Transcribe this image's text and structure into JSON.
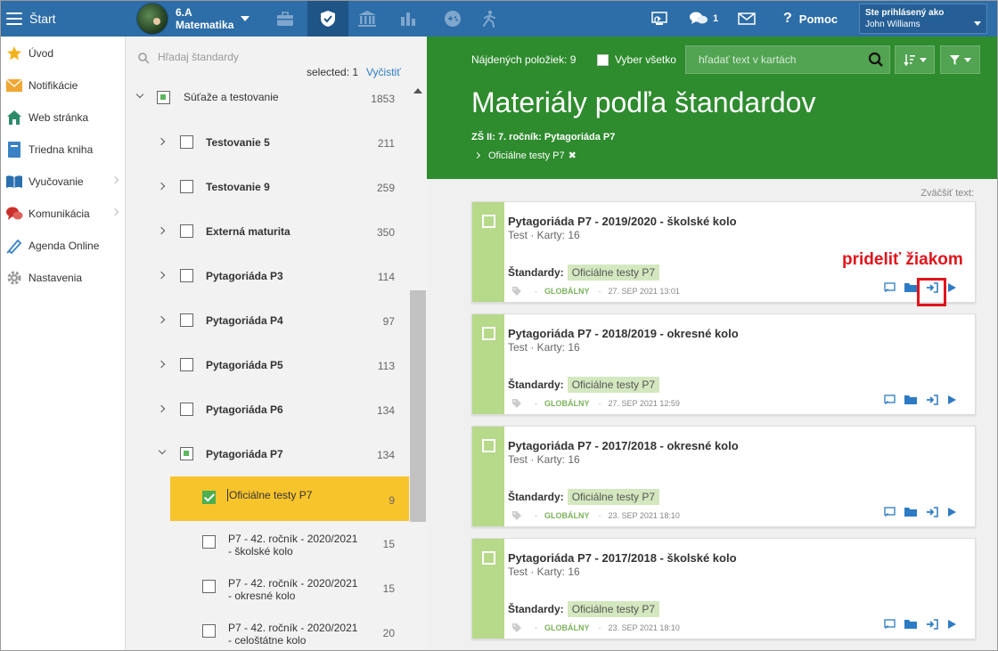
{
  "topbar": {
    "start_label": "Štart",
    "class_name": "6.A",
    "subject": "Matematika",
    "message_count": "1",
    "help_label": "Pomoc",
    "logged_in_label": "Ste prihlásený ako",
    "user_name": "John Williams",
    "colors": {
      "bar": "#2d6da8",
      "active_tab": "#1f5486"
    }
  },
  "leftnav": {
    "items": [
      {
        "label": "Úvod",
        "icon": "star-icon"
      },
      {
        "label": "Notifikácie",
        "icon": "envelope-icon"
      },
      {
        "label": "Web stránka",
        "icon": "house-icon"
      },
      {
        "label": "Triedna kniha",
        "icon": "book-icon"
      },
      {
        "label": "Vyučovanie",
        "icon": "open-book-icon"
      },
      {
        "label": "Komunikácia",
        "icon": "chat-icon"
      },
      {
        "label": "Agenda Online",
        "icon": "pen-icon"
      },
      {
        "label": "Nastavenia",
        "icon": "gear-icon"
      }
    ]
  },
  "tree": {
    "search_placeholder": "Hľadaj štandardy",
    "selected_label": "selected: 1",
    "clear_label": "Vyčistiť",
    "rows": [
      {
        "label": "Súťaže a testovanie",
        "count": "1853"
      },
      {
        "label": "Testovanie 5",
        "count": "211"
      },
      {
        "label": "Testovanie 9",
        "count": "259"
      },
      {
        "label": "Externá maturita",
        "count": "350"
      },
      {
        "label": "Pytagoriáda P3",
        "count": "114"
      },
      {
        "label": "Pytagoriáda P4",
        "count": "97"
      },
      {
        "label": "Pytagoriáda P5",
        "count": "113"
      },
      {
        "label": "Pytagoriáda P6",
        "count": "134"
      },
      {
        "label": "Pytagoriáda P7",
        "count": "134"
      },
      {
        "label": "Oficiálne testy P7",
        "count": "9"
      },
      {
        "label1": "P7 - 42. ročník - 2020/2021",
        "label2": "- školské kolo",
        "count": "15"
      },
      {
        "label1": "P7 - 42. ročník - 2020/2021",
        "label2": "- okresné kolo",
        "count": "15"
      },
      {
        "label1": "P7 - 42. ročník - 2020/2021",
        "label2": "- celoštátne kolo",
        "count": "20"
      }
    ]
  },
  "main": {
    "found_label": "Nájdených položiek: 9",
    "select_all_label": "Vyber všetko",
    "card_search_placeholder": "hľadať text v kartách",
    "title": "Materiály podľa štandardov",
    "crumb": "ZŠ II: 7. ročník: Pytagoriáda P7",
    "filter_tag": "Oficiálne testy P7",
    "zoom_label": "Zväčšiť text:",
    "callout_label": "prideliť žiakom",
    "colors": {
      "header": "#2e8b2e",
      "stripe": "#b6d98a",
      "callout": "#e0151c"
    },
    "std_label": "Štandardy:",
    "cards": [
      {
        "title": "Pytagoriáda P7 - 2019/2020 - školské kolo",
        "sub": "Test · Karty: 16",
        "standard": "Oficiálne testy P7",
        "scope": "GLOBÁLNY",
        "date": "27. SEP 2021 13:01"
      },
      {
        "title": "Pytagoriáda P7 - 2018/2019 - okresné kolo",
        "sub": "Test · Karty: 16",
        "standard": "Oficiálne testy P7",
        "scope": "GLOBÁLNY",
        "date": "27. SEP 2021 12:59"
      },
      {
        "title": "Pytagoriáda P7 - 2017/2018 - okresné kolo",
        "sub": "Test · Karty: 16",
        "standard": "Oficiálne testy P7",
        "scope": "GLOBÁLNY",
        "date": "23. SEP 2021 18:10"
      },
      {
        "title": "Pytagoriáda P7 - 2017/2018 - školské kolo",
        "sub": "Test · Karty: 16",
        "standard": "Oficiálne testy P7",
        "scope": "GLOBÁLNY",
        "date": "23. SEP 2021 18:10"
      }
    ]
  }
}
